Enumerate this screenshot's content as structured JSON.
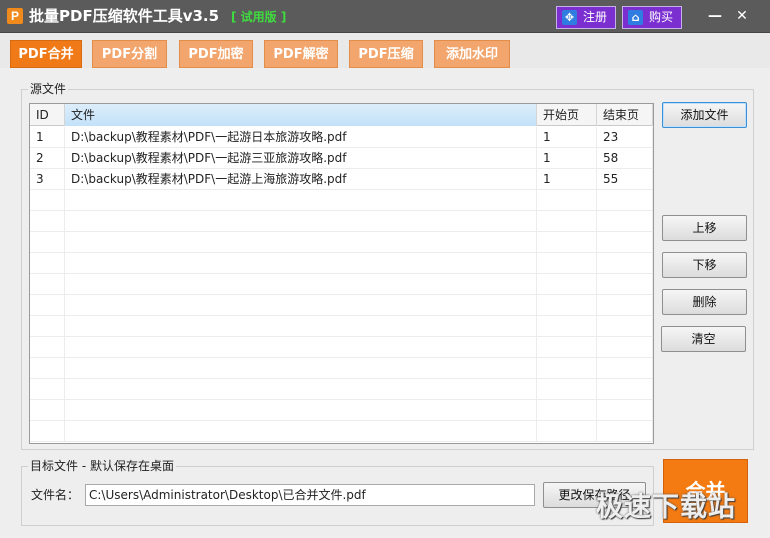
{
  "app": {
    "icon_letter": "P",
    "title": "批量PDF压缩软件工具v3.5",
    "trial_tag": "[ 试用版 ]",
    "register_label": "注册",
    "buy_label": "购买",
    "minimize_glyph": "—",
    "close_glyph": "✕"
  },
  "tabs": [
    {
      "label": "PDF合并",
      "active": true
    },
    {
      "label": "PDF分割"
    },
    {
      "label": "PDF加密"
    },
    {
      "label": "PDF解密"
    },
    {
      "label": "PDF压缩"
    },
    {
      "label": "添加水印"
    }
  ],
  "source_group": {
    "label": "源文件",
    "columns": [
      "ID",
      "文件",
      "开始页",
      "结束页"
    ],
    "rows": [
      {
        "id": "1",
        "file": "D:\\backup\\教程素材\\PDF\\一起游日本旅游攻略.pdf",
        "start": "1",
        "end": "23"
      },
      {
        "id": "2",
        "file": "D:\\backup\\教程素材\\PDF\\一起游三亚旅游攻略.pdf",
        "start": "1",
        "end": "58"
      },
      {
        "id": "3",
        "file": "D:\\backup\\教程素材\\PDF\\一起游上海旅游攻略.pdf",
        "start": "1",
        "end": "55"
      }
    ]
  },
  "side_buttons": {
    "add_file": "添加文件",
    "move_up": "上移",
    "move_down": "下移",
    "delete": "删除",
    "clear": "清空"
  },
  "target_group": {
    "label": "目标文件 - 默认保存在桌面",
    "filename_label": "文件名：",
    "filename_value": "C:\\Users\\Administrator\\Desktop\\已合并文件.pdf",
    "change_path_button": "更改保存路径"
  },
  "merge_button": "合并",
  "watermark": "极速下载站",
  "colors": {
    "titlebar": "#5b5b5b",
    "accent_orange": "#f07a18",
    "tab_orange": "#f2a56c",
    "purple_button": "#7b2fd0",
    "trial_green": "#3fdc3f"
  }
}
